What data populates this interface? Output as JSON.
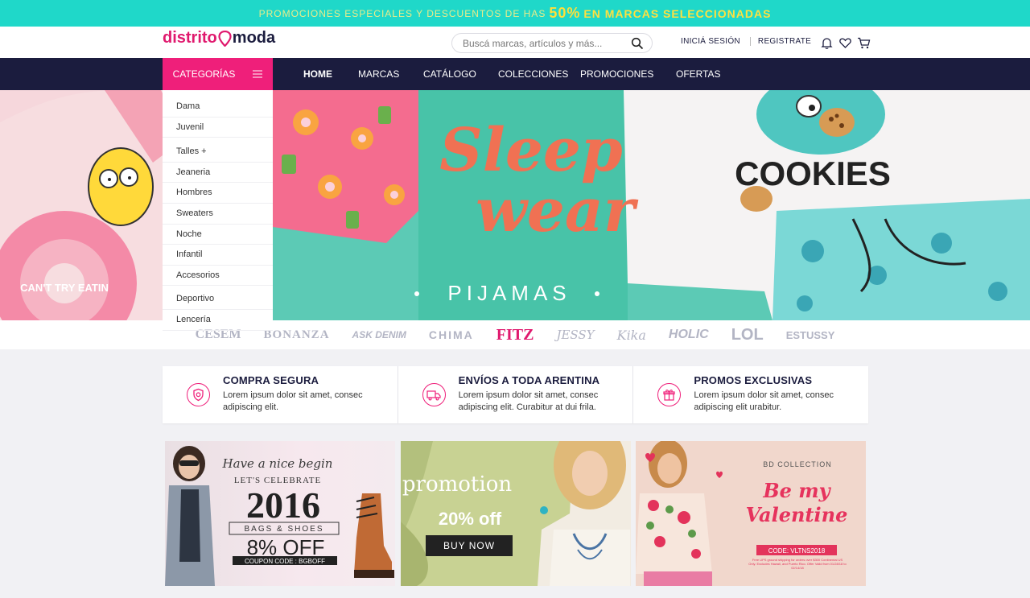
{
  "promo": {
    "pre": "Promociones especiales y descuentos de has",
    "percent": "50%",
    "post": "en marcas seleccionadas"
  },
  "header": {
    "logo_part1": "distrito",
    "logo_part2": "moda",
    "search_placeholder": "Buscá marcas, artículos y más...",
    "login": "INICIÁ SESIÓN",
    "register": "REGISTRATE"
  },
  "nav": {
    "categories_label": "CATEGORÍAS",
    "links": [
      "HOME",
      "MARCAS",
      "CATÁLOGO",
      "COLECCIONES",
      "PROMOCIONES",
      "OFERTAS"
    ]
  },
  "categories": [
    "Dama",
    "Juvenil",
    "Talles +",
    "Jeaneria",
    "Hombres",
    "Sweaters",
    "Noche",
    "Infantil",
    "Accesorios",
    "Deportivo",
    "Lencería"
  ],
  "hero": {
    "script_line1": "Sleep",
    "script_line2": "wear",
    "subtitle": "PIJAMAS",
    "shirt_text": "COOKIES",
    "donut_text": "CAN'T TRY EATIN"
  },
  "brands": [
    "CESEM",
    "BONANZA",
    "ASK DENIM",
    "CHIMA",
    "FITZ",
    "JESSY",
    "Kika",
    "HOLIC",
    "LOL",
    "ESTUSSY"
  ],
  "features": [
    {
      "title": "COMPRA SEGURA",
      "line1": "Lorem ipsum dolor sit amet, consec",
      "line2": "adipiscing elit."
    },
    {
      "title": "ENVÍOS A TODA ARENTINA",
      "line1": "Lorem ipsum dolor sit amet, consec",
      "line2": "adipiscing elit. Curabitur at dui frila."
    },
    {
      "title": "PROMOS EXCLUSIVAS",
      "line1": "Lorem ipsum dolor sit amet, consec",
      "line2": "adipiscing elit urabitur."
    }
  ],
  "banners": {
    "b1": {
      "line1": "Have a nice begin",
      "line2": "LET'S CELEBRATE",
      "year": "2016",
      "line3": "BAGS & SHOES",
      "offer": "8% OFF",
      "code": "COUPON CODE : BGBOFF"
    },
    "b2": {
      "title": "promotion",
      "offer": "20% off",
      "button": "BUY NOW"
    },
    "b3": {
      "collection": "BD COLLECTION",
      "line1": "Be my",
      "line2": "Valentine",
      "code": "CODE: VLTNS2018",
      "fine_print": "Free UPS ground shipping for orders over $300 Continental US Only. Excludes Hawaii, and Puerto Rico. Offer Valid from 01/28/18 to 02/14/18"
    }
  },
  "colors": {
    "brand_pink": "#ef1f7a",
    "navy": "#1b1c3e",
    "teal": "#1fd8c9"
  }
}
